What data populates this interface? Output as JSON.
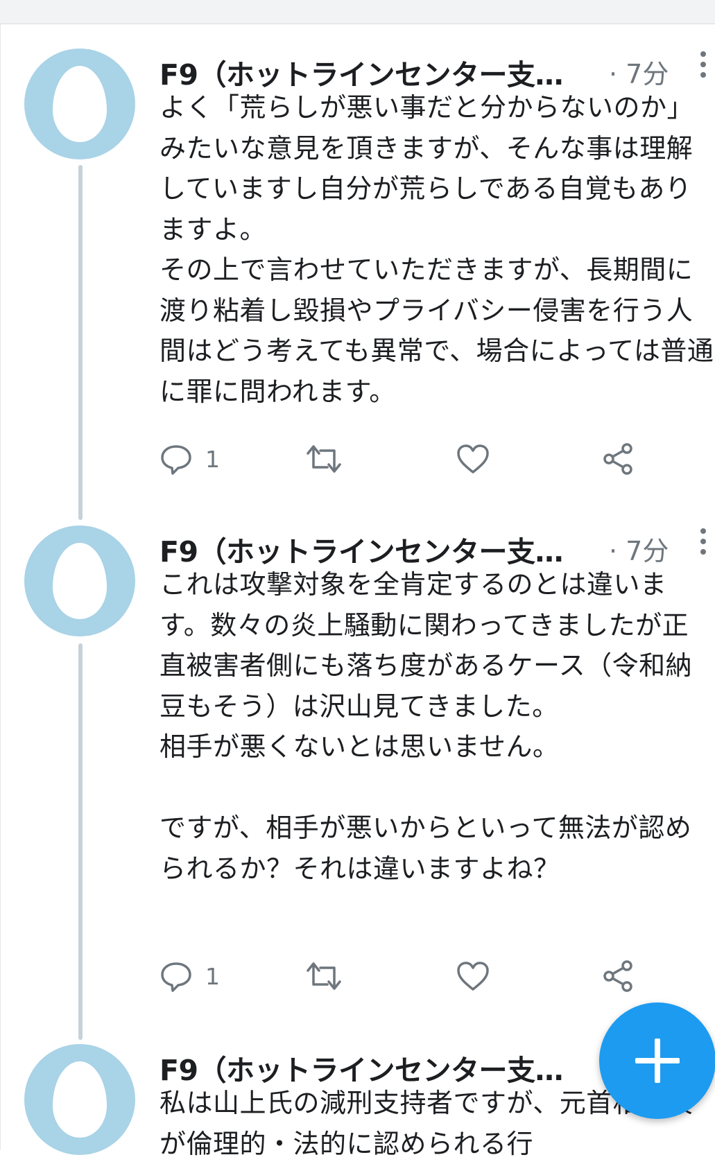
{
  "tweets": [
    {
      "author": "F9（ホットラインセンター支…",
      "time": "· 7分",
      "text": "よく「荒らしが悪い事だと分からないのか」みたいな意見を頂きますが、そんな事は理解していますし自分が荒らしである自覚もありますよ。\nその上で言わせていただきますが、長期間に渡り粘着し毀損やプライバシー侵害を行う人間はどう考えても異常で、場合によっては普通に罪に問われます。",
      "reply_count": "1"
    },
    {
      "author": "F9（ホットラインセンター支…",
      "time": "· 7分",
      "text": "これは攻撃対象を全肯定するのとは違います。数々の炎上騒動に関わってきましたが正直被害者側にも落ち度があるケース（令和納豆もそう）は沢山見てきました。\n相手が悪くないとは思いません。\n\nですが、相手が悪いからといって無法が認められるか？それは違いますよね？",
      "reply_count": "1"
    },
    {
      "author": "F9（ホットラインセンター支…",
      "text": "私は山上氏の減刑支持者ですが、元首相暗殺が倫理的・法的に認められる行"
    }
  ],
  "icons": {
    "reply": "reply-icon",
    "retweet": "retweet-icon",
    "like": "like-icon",
    "share": "share-icon",
    "compose": "plus-icon"
  },
  "colors": {
    "avatar": "#a9d3e6",
    "accent": "#1d9bf0",
    "muted": "#6e767d",
    "thread_line": "#c8d1d8"
  }
}
